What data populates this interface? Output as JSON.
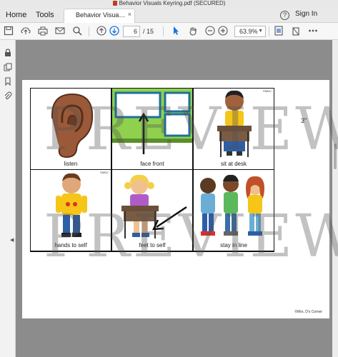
{
  "window": {
    "title": "Behavior Visuals Keyring.pdf (SECURED)"
  },
  "tabs": {
    "home": "Home",
    "tools": "Tools",
    "document": "Behavior Visuals ...",
    "close": "×"
  },
  "header": {
    "help": "?",
    "sign_in": "Sign In"
  },
  "toolbar": {
    "icons": [
      "save-icon",
      "upload-icon",
      "print-icon",
      "mail-icon",
      "search-icon",
      "page-up-icon",
      "page-down-icon",
      "select-arrow-icon",
      "hand-icon",
      "zoom-out-icon",
      "zoom-in-icon",
      "fit-page-icon",
      "more-icon"
    ],
    "current_page": "6",
    "page_total": "/ 15",
    "zoom": "63.9%"
  },
  "sidebar": {
    "icons": [
      "lock-icon",
      "copy-icon",
      "bookmark-icon",
      "attachment-icon"
    ]
  },
  "document": {
    "cards": [
      {
        "caption": "listen",
        "mark": ""
      },
      {
        "caption": "face front",
        "mark": ""
      },
      {
        "caption": "sit at desk",
        "mark": "©MDC"
      },
      {
        "caption": "hands to self",
        "mark": "©MDC"
      },
      {
        "caption": "feet to self",
        "mark": ""
      },
      {
        "caption": "stay in line",
        "mark": ""
      }
    ],
    "dimension": "3\"",
    "credit": "©Mrs. D's Corner",
    "watermark": "PREVIEW"
  },
  "colors": {
    "accent": "#1a73e8",
    "board_green": "#8fd14f",
    "chair_blue": "#1f4e9c"
  }
}
